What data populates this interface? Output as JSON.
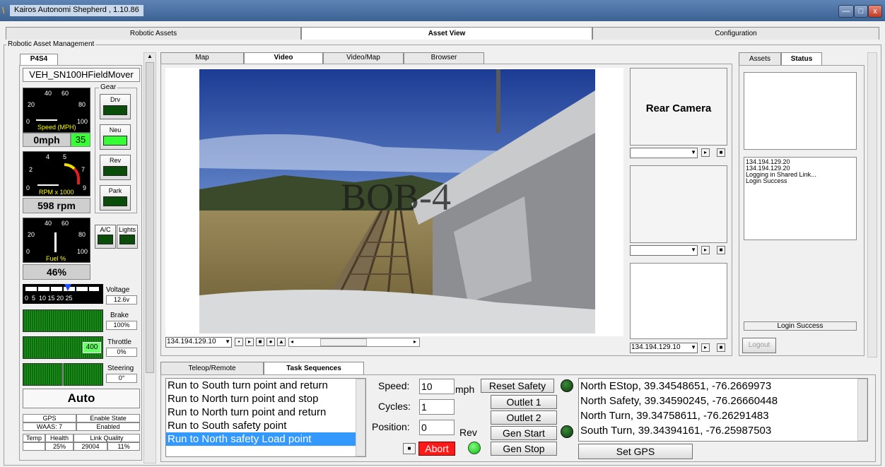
{
  "window": {
    "title": "Kairos Autonomi Shepherd , 1.10.86",
    "min": "—",
    "max": "□",
    "close": "x"
  },
  "top_tabs": [
    "Robotic Assets",
    "Asset View",
    "Configuration"
  ],
  "group_title": "Robotic Asset Management",
  "left": {
    "tab": "P4S4",
    "vehicle": "VEH_SN100HFieldMover",
    "speed": {
      "ticks": [
        "40",
        "60",
        "20",
        "80",
        "0",
        "100"
      ],
      "label": "Speed (MPH)",
      "readout": "0mph",
      "setpoint": "35"
    },
    "rpm": {
      "ticks": [
        "4",
        "5",
        "2",
        "7",
        "0",
        "9"
      ],
      "label": "RPM x 1000",
      "readout": "598 rpm"
    },
    "fuel": {
      "ticks": [
        "40",
        "60",
        "20",
        "80",
        "0",
        "100"
      ],
      "label": "Fuel %",
      "readout": "46%"
    },
    "gear": {
      "title": "Gear",
      "buttons": [
        "Drv",
        "Neu",
        "Rev",
        "Park"
      ]
    },
    "ac": "A/C",
    "lights": "Lights",
    "voltage": {
      "scale": "0  5  10 15 20 25",
      "label": "Voltage",
      "value": "12.6v"
    },
    "brake": {
      "label": "Brake",
      "value": "100%"
    },
    "throttle": {
      "label": "Throttle",
      "value": "0%",
      "bar": "400"
    },
    "steering": {
      "label": "Steering",
      "value": "0°"
    },
    "mode": "Auto",
    "status_table": {
      "row1": [
        "GPS",
        "Enable State"
      ],
      "row2": [
        "WAAS: 7",
        "Enabled"
      ],
      "row3": [
        "Temp",
        "Health",
        "Link Quality"
      ],
      "row4": [
        "",
        "25%",
        "29004",
        "11%"
      ]
    }
  },
  "video_tabs": [
    "Map",
    "Video",
    "Video/Map",
    "Browser"
  ],
  "video": {
    "overlay": "BOB-4",
    "ip": "134.194.129.10"
  },
  "rear_camera": {
    "label": "Rear Camera",
    "ip": "134.194.129.10"
  },
  "right_tabs": [
    "Assets",
    "Status"
  ],
  "status_log": [
    "134.194.129.20",
    "134.194.129.20",
    "Logging in Shared Link...",
    "Login Success"
  ],
  "status_line": "Login Success",
  "logout": "Logout",
  "bottom_tabs": [
    "Teleop/Remote",
    "Task Sequences"
  ],
  "tasks": [
    "Run to South turn point and return",
    "Run to North turn point and stop",
    "Run to North turn point and return",
    "Run to South safety point",
    "Run to North safety Load point"
  ],
  "params": {
    "speed_label": "Speed:",
    "speed": "10",
    "unit": "mph",
    "cycles_label": "Cycles:",
    "cycles": "1",
    "position_label": "Position:",
    "position": "0",
    "abort": "Abort",
    "rev": "Rev"
  },
  "actions": [
    "Reset Safety",
    "Outlet 1",
    "Outlet 2",
    "Gen Start",
    "Gen Stop"
  ],
  "gps_points": [
    "North EStop, 39.34548651, -76.2669973",
    "North Safety, 39.34590245, -76.26660448",
    "North Turn, 39.34758611, -76.26291483",
    "South Turn, 39.34394161, -76.25987503"
  ],
  "set_gps": "Set GPS"
}
